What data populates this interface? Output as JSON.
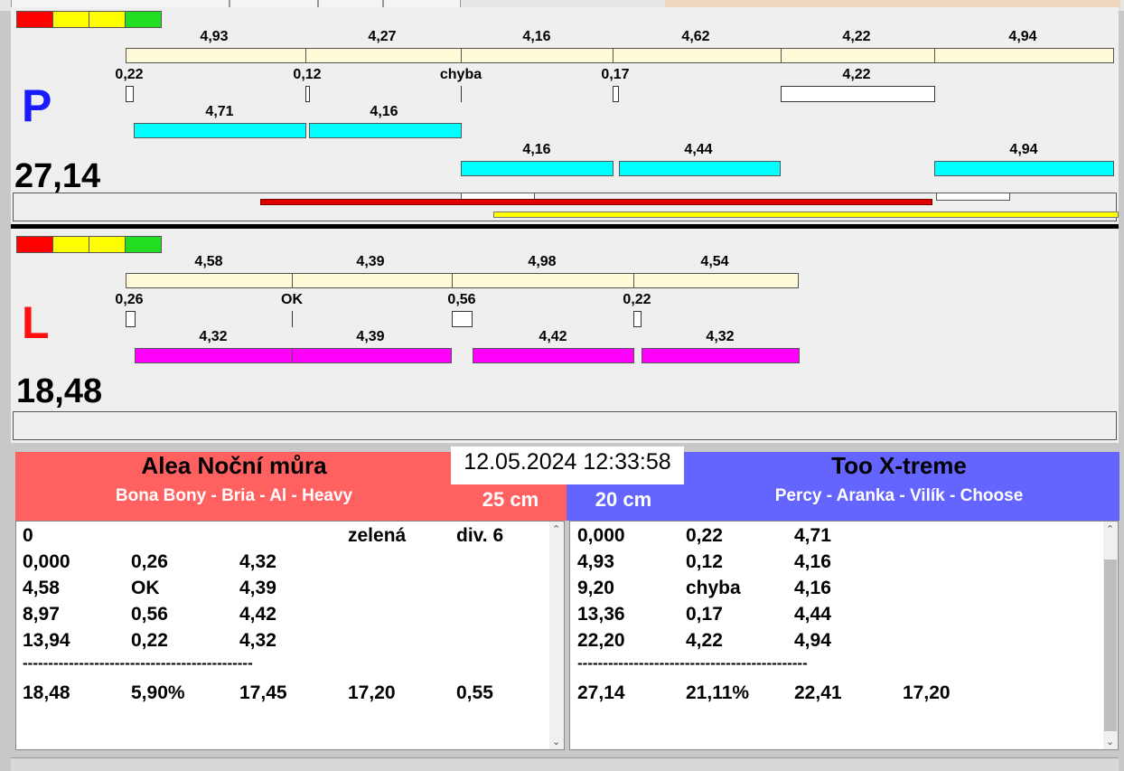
{
  "datetime": "12.05.2024 12:33:58",
  "colors": {
    "red": "#ff0000",
    "yellow": "#ffff00",
    "green": "#22dd22",
    "cyan": "#00ffff",
    "magenta": "#ff00ff",
    "leftPanel": "#ff6060",
    "rightPanel": "#6464ff"
  },
  "laneP": {
    "letter": "P",
    "time": "27,14",
    "top_times": [
      "4,93",
      "4,27",
      "4,16",
      "4,62",
      "4,22",
      "4,94"
    ],
    "sensor_values": [
      "0,22",
      "0,12",
      "chyba",
      "0,17",
      "4,22"
    ],
    "cyan_row1": [
      "4,71",
      "4,16"
    ],
    "cyan_row2": [
      "4,16",
      "4,44",
      "4,94"
    ]
  },
  "laneL": {
    "letter": "L",
    "time": "18,48",
    "top_times": [
      "4,58",
      "4,39",
      "4,98",
      "4,54"
    ],
    "sensor_values": [
      "0,26",
      "OK",
      "0,56",
      "0,22"
    ],
    "magenta_row": [
      "4,32",
      "4,39",
      "4,42",
      "4,32"
    ]
  },
  "left_team": {
    "name": "Alea Noční můra",
    "members": "Bona Bony - Bria - Al - Heavy",
    "height": "25 cm",
    "header_row": [
      "0",
      "zelená",
      "div. 6"
    ],
    "rows": [
      [
        "0,000",
        "0,26",
        "4,32"
      ],
      [
        "4,58",
        "OK",
        "4,39"
      ],
      [
        "8,97",
        "0,56",
        "4,42"
      ],
      [
        "13,94",
        "0,22",
        "4,32"
      ]
    ],
    "separator": "---------------------------------------------",
    "totals": [
      "18,48",
      "5,90%",
      "17,45",
      "17,20",
      "0,55"
    ]
  },
  "right_team": {
    "name": "Too X-treme",
    "members": "Percy - Aranka - Vilík - Choose",
    "height": "20 cm",
    "rows": [
      [
        "0,000",
        "0,22",
        "4,71"
      ],
      [
        "4,93",
        "0,12",
        "4,16"
      ],
      [
        "9,20",
        "chyba",
        "4,16"
      ],
      [
        "13,36",
        "0,17",
        "4,44"
      ],
      [
        "22,20",
        "4,22",
        "4,94"
      ]
    ],
    "separator": "---------------------------------------------",
    "totals": [
      "27,14",
      "21,11%",
      "22,41",
      "17,20"
    ]
  }
}
